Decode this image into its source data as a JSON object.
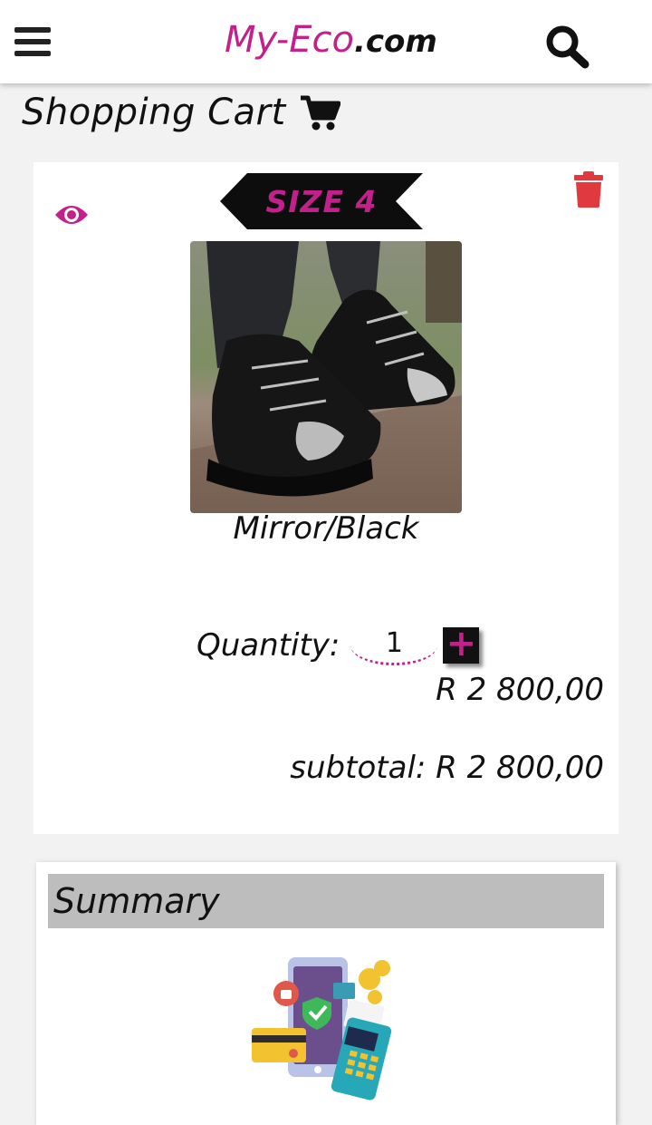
{
  "header": {
    "logo_brand": "My-Eco",
    "logo_tld": ".com",
    "menu_icon": "hamburger-menu-icon",
    "search_icon": "search-icon"
  },
  "page": {
    "title": "Shopping Cart",
    "title_icon": "shopping-cart-icon"
  },
  "cart_item": {
    "size_label": "SIZE 4",
    "product_name": "Mirror/Black",
    "quantity_label": "Quantity:",
    "quantity_value": "1",
    "plus_label": "+",
    "price": "R 2 800,00",
    "subtotal": "subtotal: R 2 800,00",
    "view_icon": "eye-icon",
    "delete_icon": "trash-icon"
  },
  "summary": {
    "title": "Summary"
  },
  "colors": {
    "brand": "#c2208a",
    "delete": "#e03a3e",
    "summary_bar": "#bdbdbd"
  }
}
